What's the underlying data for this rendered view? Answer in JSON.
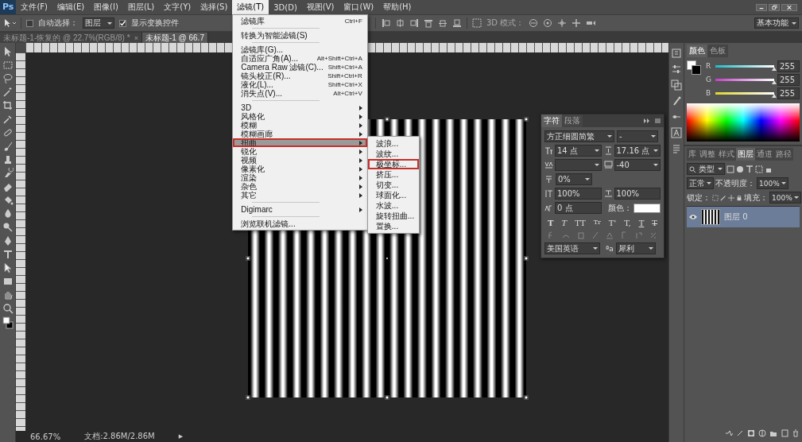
{
  "menu_bar": {
    "logo": "Ps",
    "items": [
      {
        "label": "文件(F)",
        "selected": false
      },
      {
        "label": "编辑(E)",
        "selected": false
      },
      {
        "label": "图像(I)",
        "selected": false
      },
      {
        "label": "图层(L)",
        "selected": false
      },
      {
        "label": "文字(Y)",
        "selected": false
      },
      {
        "label": "选择(S)",
        "selected": false
      },
      {
        "label": "滤镜(T)",
        "selected": true
      },
      {
        "label": "3D(D)",
        "selected": false
      },
      {
        "label": "视图(V)",
        "selected": false
      },
      {
        "label": "窗口(W)",
        "selected": false
      },
      {
        "label": "帮助(H)",
        "selected": false
      }
    ]
  },
  "filter_menu": {
    "items": [
      {
        "label": "滤镜库",
        "shortcut": "Ctrl+F",
        "separator_before": false,
        "selected": false,
        "marked": false
      },
      {
        "label": "转换为智能滤镜(S)",
        "separator_before": true,
        "selected": false,
        "marked": false
      },
      {
        "label": "滤镜库(G)...",
        "separator_before": true,
        "selected": false,
        "marked": false
      },
      {
        "label": "自适应广角(A)...",
        "shortcut": "Alt+Shift+Ctrl+A",
        "separator_before": false,
        "selected": false,
        "marked": false
      },
      {
        "label": "Camera Raw 滤镜(C)...",
        "shortcut": "Shift+Ctrl+A",
        "separator_before": false,
        "selected": false,
        "marked": false
      },
      {
        "label": "镜头校正(R)...",
        "shortcut": "Shift+Ctrl+R",
        "separator_before": false,
        "selected": false,
        "marked": false
      },
      {
        "label": "液化(L)...",
        "shortcut": "Shift+Ctrl+X",
        "separator_before": false,
        "selected": false,
        "marked": false
      },
      {
        "label": "消失点(V)...",
        "shortcut": "Alt+Ctrl+V",
        "separator_before": false,
        "selected": false,
        "marked": false
      },
      {
        "label": "3D",
        "has_submenu": true,
        "separator_before": true,
        "selected": false,
        "marked": false
      },
      {
        "label": "风格化",
        "has_submenu": true,
        "separator_before": false,
        "selected": false,
        "marked": false
      },
      {
        "label": "模糊",
        "has_submenu": true,
        "separator_before": false,
        "selected": false,
        "marked": false
      },
      {
        "label": "模糊画廊",
        "has_submenu": true,
        "separator_before": false,
        "selected": false,
        "marked": false
      },
      {
        "label": "扭曲",
        "has_submenu": true,
        "separator_before": false,
        "selected": true,
        "marked": true,
        "children": [
          {
            "label": "波浪...",
            "selected": false,
            "marked": false
          },
          {
            "label": "波纹...",
            "selected": false,
            "marked": false
          },
          {
            "label": "极坐标...",
            "selected": false,
            "marked": true
          },
          {
            "label": "挤压...",
            "selected": false,
            "marked": false
          },
          {
            "label": "切变...",
            "selected": false,
            "marked": false
          },
          {
            "label": "球面化...",
            "selected": false,
            "marked": false
          },
          {
            "label": "水波...",
            "selected": false,
            "marked": false
          },
          {
            "label": "旋转扭曲...",
            "selected": false,
            "marked": false
          },
          {
            "label": "置换...",
            "selected": false,
            "marked": false
          }
        ]
      },
      {
        "label": "锐化",
        "has_submenu": true,
        "separator_before": false,
        "selected": false,
        "marked": false
      },
      {
        "label": "视频",
        "has_submenu": true,
        "separator_before": false,
        "selected": false,
        "marked": false
      },
      {
        "label": "像素化",
        "has_submenu": true,
        "separator_before": false,
        "selected": false,
        "marked": false
      },
      {
        "label": "渲染",
        "has_submenu": true,
        "separator_before": false,
        "selected": false,
        "marked": false
      },
      {
        "label": "杂色",
        "has_submenu": true,
        "separator_before": false,
        "selected": false,
        "marked": false
      },
      {
        "label": "其它",
        "has_submenu": true,
        "separator_before": false,
        "selected": false,
        "marked": false
      },
      {
        "label": "Digimarc",
        "has_submenu": true,
        "separator_before": true,
        "selected": false,
        "marked": false
      },
      {
        "label": "浏览联机滤镜...",
        "separator_before": true,
        "selected": false,
        "marked": false
      }
    ]
  },
  "options_bar": {
    "auto_select": {
      "label": "自动选择：",
      "checked": false
    },
    "auto_select_target": "图层",
    "show_transform": {
      "label": "显示变换控件",
      "checked": true
    },
    "mode_label": "3D 模式：",
    "workspace": "基本功能"
  },
  "document_tabs": [
    {
      "label": "未标题-1-恢复的 @ 22.7%(RGB/8) *",
      "close": "×",
      "selected": false
    },
    {
      "label": "未标题-1 @ 66.7",
      "selected": true
    }
  ],
  "character_panel": {
    "tabs": [
      {
        "label": "字符",
        "selected": true
      },
      {
        "label": "段落",
        "selected": false
      }
    ],
    "font_family": "方正细圆简繁",
    "font_style": "-",
    "size": "14 点",
    "leading": "17.16 点",
    "tracking": "-40",
    "tsume": "0%",
    "vertical_scale": "100%",
    "horizontal_scale": "100%",
    "baseline_shift": "0 点",
    "color_label": "颜色：",
    "style_buttons": [
      "T",
      "T",
      "TT",
      "Tr",
      "T'",
      "T,",
      "T",
      "T"
    ],
    "language": "美国英语",
    "aa_label": "ªa",
    "antialias": "犀利"
  },
  "color_panel": {
    "tabs": [
      {
        "label": "颜色",
        "selected": true
      },
      {
        "label": "色板",
        "selected": false
      }
    ],
    "channels": [
      {
        "name": "R",
        "value": "255",
        "level": 1
      },
      {
        "name": "G",
        "value": "255",
        "level": 1
      },
      {
        "name": "B",
        "value": "255",
        "level": 1
      }
    ]
  },
  "layers_panel": {
    "tabs": [
      {
        "label": "库",
        "selected": false
      },
      {
        "label": "调整",
        "selected": false
      },
      {
        "label": "样式",
        "selected": false
      },
      {
        "label": "图层",
        "selected": true
      },
      {
        "label": "通道",
        "selected": false
      },
      {
        "label": "路径",
        "selected": false
      }
    ],
    "filter": "类型",
    "blend_mode": "正常",
    "opacity_label": "不透明度：",
    "opacity": "100%",
    "lock_label": "锁定：",
    "fill_label": "填充：",
    "fill": "100%",
    "layers": [
      {
        "name": "图层 0",
        "visible": true,
        "selected": true
      }
    ]
  },
  "status_bar": {
    "zoom": "66.67%",
    "doc_info": "文档:2.86M/2.86M",
    "arrow": "▶"
  }
}
